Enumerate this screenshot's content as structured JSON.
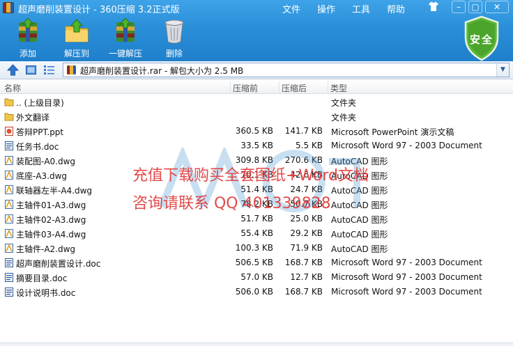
{
  "window": {
    "title": "超声磨削装置设计 - 360压缩 3.2正式版",
    "menu": [
      "文件",
      "操作",
      "工具",
      "帮助"
    ],
    "controls": [
      "–",
      "▢",
      "✕"
    ]
  },
  "toolbar": {
    "add_label": "添加",
    "extract_label": "解压到",
    "oneclick_label": "一键解压",
    "delete_label": "删除",
    "security_label": "安全"
  },
  "address": {
    "path": "超声磨削装置设计.rar - 解包大小为 2.5 MB"
  },
  "columns": {
    "name": "名称",
    "size": "压缩前",
    "packed": "压缩后",
    "type": "类型"
  },
  "files": [
    {
      "name": ".. (上级目录)",
      "size": "",
      "packed": "",
      "type": "文件夹",
      "icon": "folder-icon"
    },
    {
      "name": "外文翻译",
      "size": "",
      "packed": "",
      "type": "文件夹",
      "icon": "folder-icon"
    },
    {
      "name": "答辩PPT.ppt",
      "size": "360.5 KB",
      "packed": "141.7 KB",
      "type": "Microsoft PowerPoint 演示文稿",
      "icon": "ppt-icon"
    },
    {
      "name": "任务书.doc",
      "size": "33.5 KB",
      "packed": "5.5 KB",
      "type": "Microsoft Word 97 - 2003 Document",
      "icon": "doc-icon"
    },
    {
      "name": "装配图-A0.dwg",
      "size": "309.8 KB",
      "packed": "270.6 KB",
      "type": "AutoCAD 图形",
      "icon": "dwg-icon"
    },
    {
      "name": "底座-A3.dwg",
      "size": "70.1 KB",
      "packed": "42.6 KB",
      "type": "AutoCAD 图形",
      "icon": "dwg-icon"
    },
    {
      "name": "联轴器左半-A4.dwg",
      "size": "51.4 KB",
      "packed": "24.7 KB",
      "type": "AutoCAD 图形",
      "icon": "dwg-icon"
    },
    {
      "name": "主轴件01-A3.dwg",
      "size": "78.2 KB",
      "packed": "50.7 KB",
      "type": "AutoCAD 图形",
      "icon": "dwg-icon"
    },
    {
      "name": "主轴件02-A3.dwg",
      "size": "51.7 KB",
      "packed": "25.0 KB",
      "type": "AutoCAD 图形",
      "icon": "dwg-icon"
    },
    {
      "name": "主轴件03-A4.dwg",
      "size": "55.4 KB",
      "packed": "29.2 KB",
      "type": "AutoCAD 图形",
      "icon": "dwg-icon"
    },
    {
      "name": "主轴件-A2.dwg",
      "size": "100.3 KB",
      "packed": "71.9 KB",
      "type": "AutoCAD 图形",
      "icon": "dwg-icon"
    },
    {
      "name": "超声磨削装置设计.doc",
      "size": "506.5 KB",
      "packed": "168.7 KB",
      "type": "Microsoft Word 97 - 2003 Document",
      "icon": "doc-icon"
    },
    {
      "name": "摘要目录.doc",
      "size": "57.0 KB",
      "packed": "12.7 KB",
      "type": "Microsoft Word 97 - 2003 Document",
      "icon": "doc-icon"
    },
    {
      "name": "设计说明书.doc",
      "size": "506.0 KB",
      "packed": "168.7 KB",
      "type": "Microsoft Word 97 - 2003 Document",
      "icon": "doc-icon"
    }
  ],
  "watermark": {
    "line1": "充值下载购买全套图纸+Word文档",
    "line2": "咨询请联系  QQ 401339828"
  }
}
